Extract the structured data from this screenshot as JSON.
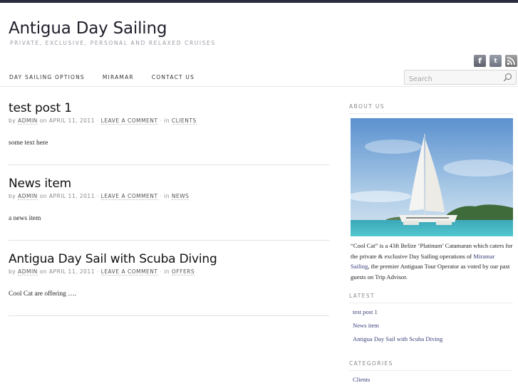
{
  "site": {
    "title": "Antigua Day Sailing",
    "tagline": "PRIVATE, EXCLUSIVE, PERSONAL AND RELAXED CRUISES"
  },
  "social": {
    "facebook_glyph": "f",
    "twitter_glyph": "t",
    "icons": [
      "facebook-icon",
      "twitter-icon",
      "rss-icon"
    ]
  },
  "nav": {
    "items": [
      {
        "label": "DAY SAILING OPTIONS"
      },
      {
        "label": "MIRAMAR"
      },
      {
        "label": "CONTACT US"
      }
    ]
  },
  "search": {
    "placeholder": "Search"
  },
  "posts": [
    {
      "title": "test post 1",
      "by": "by",
      "author": "ADMIN",
      "on": "on",
      "date": "APRIL 11, 2011",
      "dot1": "·",
      "comment": "LEAVE A COMMENT",
      "dot2": "·",
      "in": "in",
      "category": "CLIENTS",
      "excerpt": "some text here"
    },
    {
      "title": "News item",
      "by": "by",
      "author": "ADMIN",
      "on": "on",
      "date": "APRIL 11, 2011",
      "dot1": "·",
      "comment": "LEAVE A COMMENT",
      "dot2": "·",
      "in": "in",
      "category": "NEWS",
      "excerpt": "a news item"
    },
    {
      "title": "Antigua Day Sail with Scuba Diving",
      "by": "by",
      "author": "ADMIN",
      "on": "on",
      "date": "APRIL 11, 2011",
      "dot1": "·",
      "comment": "LEAVE A COMMENT",
      "dot2": "·",
      "in": "in",
      "category": "OFFERS",
      "excerpt": "Cool Cat are offering …."
    }
  ],
  "sidebar": {
    "about_heading": "ABOUT US",
    "about_text_1": "“Cool Cat” is a 43ft Belize ‘Platinum’ Catamaran which caters for the private & exclusive Day Sailing operations of ",
    "about_link": "Miramar Sailing",
    "about_text_2": ", the premier Antiguan Tour Operator as voted by our past guests on Trip Advisor.",
    "latest_heading": "LATEST",
    "latest": [
      "test post 1",
      "News item",
      "Antigua Day Sail with Scuba Diving"
    ],
    "categories_heading": "CATEGORIES",
    "categories": [
      "Clients"
    ]
  },
  "colors": {
    "topbar": "#2b2c3f",
    "link": "#3a3f7a",
    "sea": "#3fb8c4",
    "sky": "#6a9fd4"
  }
}
